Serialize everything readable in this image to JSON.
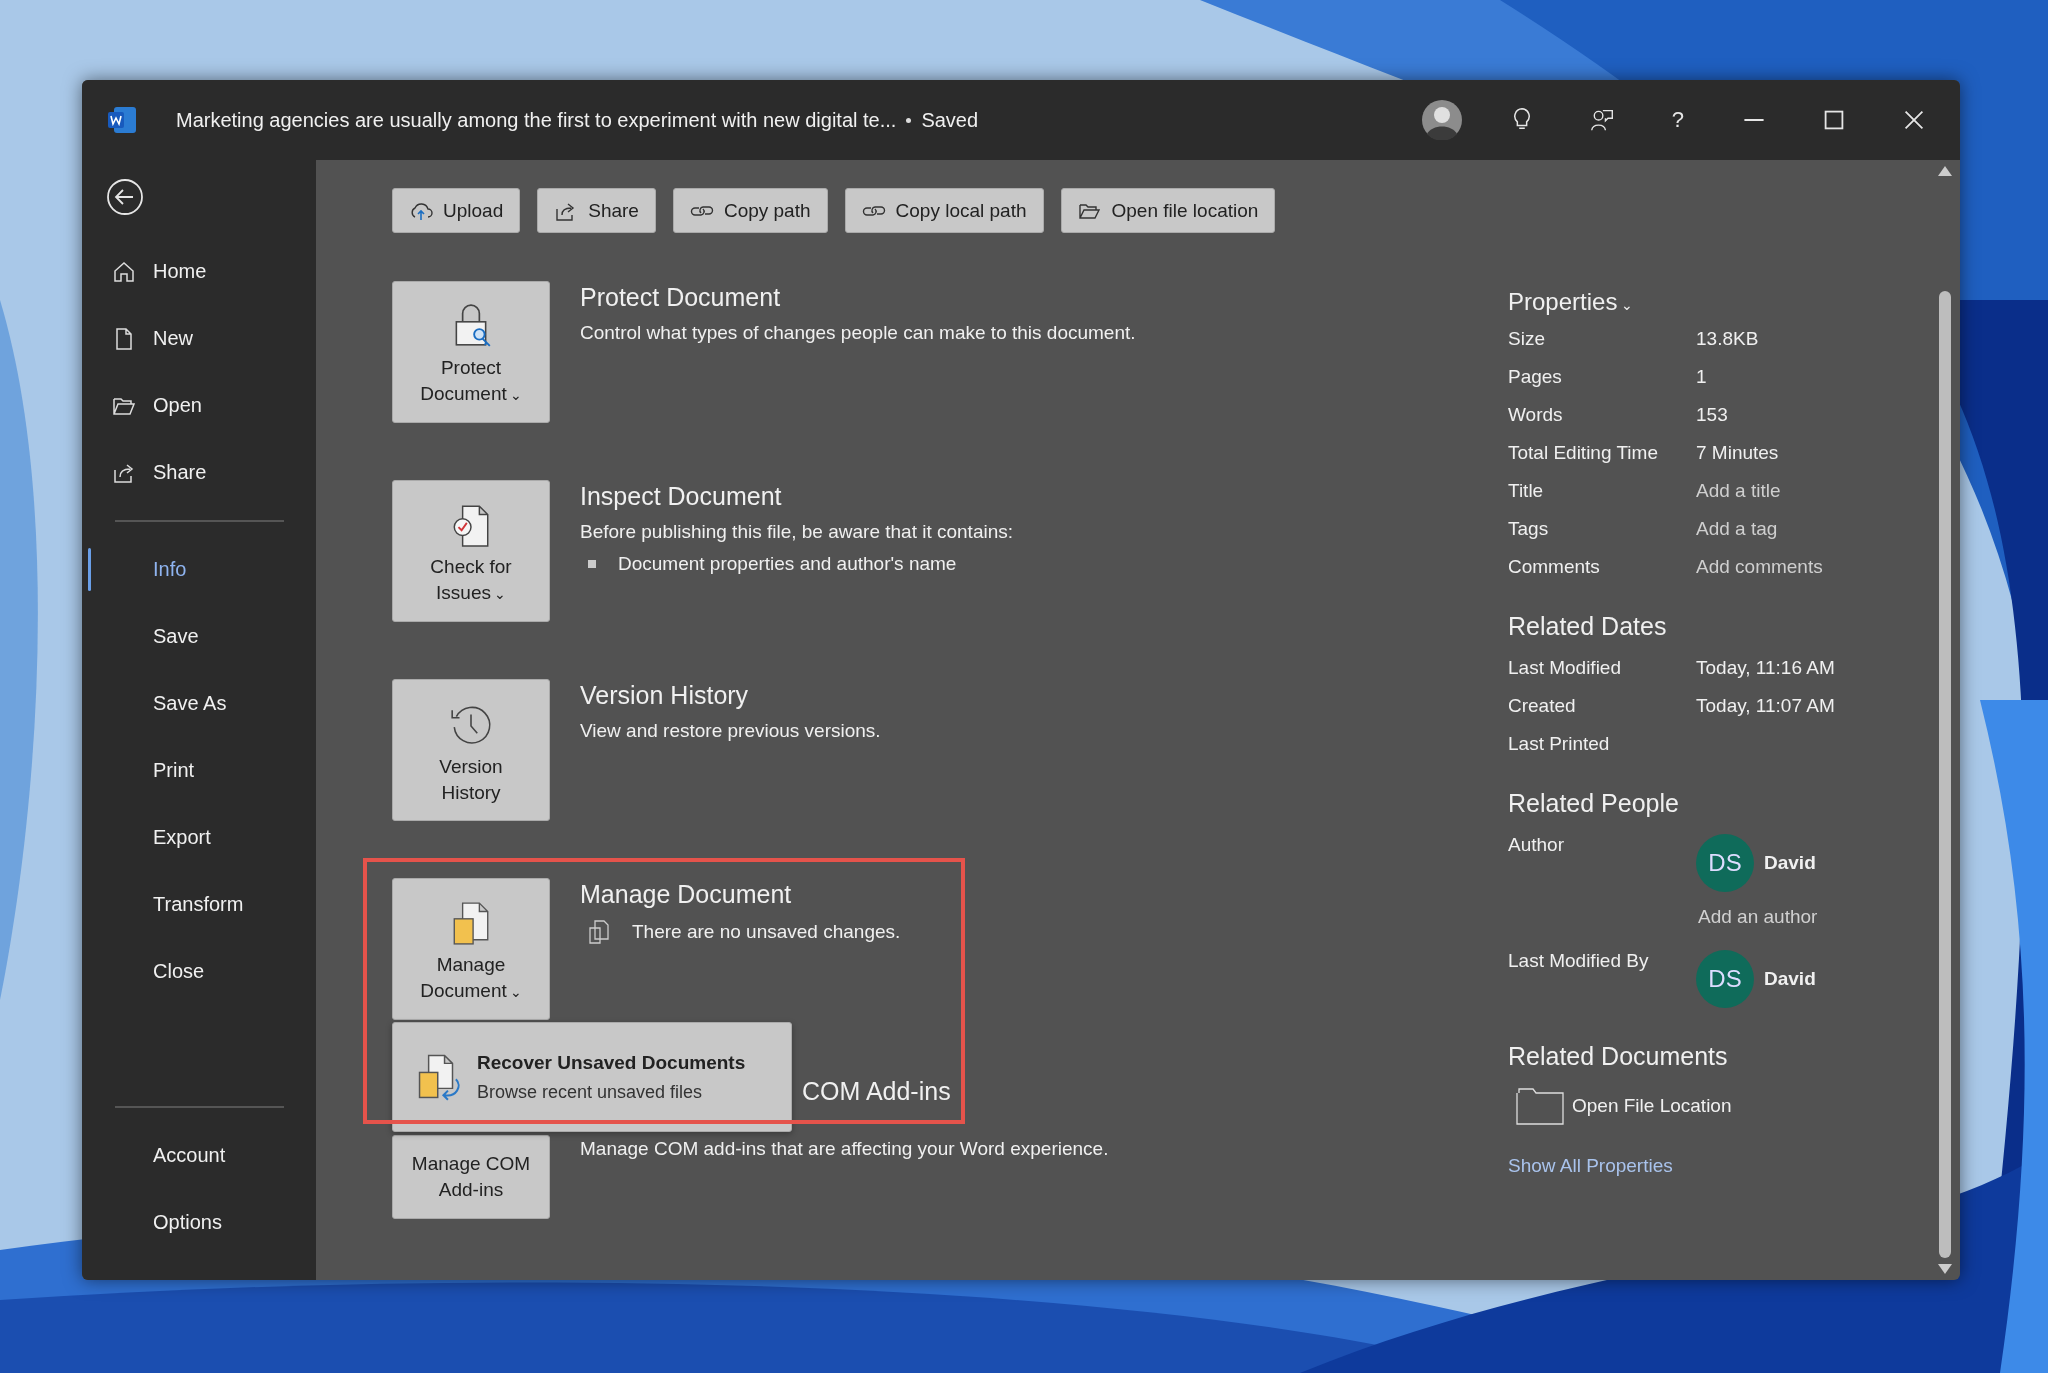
{
  "window": {
    "title": "Marketing agencies are usually among the first to experiment with new digital te...",
    "status": "Saved",
    "help": "?"
  },
  "sidebar": {
    "top_items": [
      {
        "label": "Home",
        "selected": false
      },
      {
        "label": "New",
        "selected": false
      },
      {
        "label": "Open",
        "selected": false
      },
      {
        "label": "Share",
        "selected": false
      }
    ],
    "items": [
      {
        "label": "Info",
        "selected": true
      },
      {
        "label": "Save",
        "selected": false
      },
      {
        "label": "Save As",
        "selected": false
      },
      {
        "label": "Print",
        "selected": false
      },
      {
        "label": "Export",
        "selected": false
      },
      {
        "label": "Transform",
        "selected": false
      },
      {
        "label": "Close",
        "selected": false
      }
    ],
    "bottom_items": [
      {
        "label": "Account",
        "selected": false
      },
      {
        "label": "Options",
        "selected": false
      }
    ]
  },
  "actions": [
    "Upload",
    "Share",
    "Copy path",
    "Copy local path",
    "Open file location"
  ],
  "sections": [
    {
      "kind": "protect",
      "button": [
        "Protect",
        "Document"
      ],
      "caret": "⌄",
      "title": "Protect Document",
      "description": "Control what types of changes people can make to this document."
    },
    {
      "kind": "inspect",
      "button": [
        "Check for",
        "Issues"
      ],
      "caret": "⌄",
      "title": "Inspect Document",
      "description": "Before publishing this file, be aware that it contains:",
      "bullets": [
        "Document properties and author's name"
      ]
    },
    {
      "kind": "version",
      "button": [
        "Version",
        "History"
      ],
      "title": "Version History",
      "description": "View and restore previous versions."
    },
    {
      "kind": "manage",
      "button": [
        "Manage",
        "Document"
      ],
      "caret": "⌄",
      "highlighted": true,
      "title": "Manage Document",
      "status": "There are no unsaved changes.",
      "menu": {
        "title": "Recover Unsaved Documents",
        "subtitle": "Browse recent unsaved files"
      }
    },
    {
      "kind": "com",
      "button": [
        "Manage COM",
        "Add-ins"
      ],
      "title": "COM Add-ins",
      "description": "Manage COM add-ins that are affecting your Word experience."
    }
  ],
  "properties": {
    "title": "Properties",
    "caret": "⌄",
    "rows": [
      {
        "label": "Size",
        "value": "13.8KB",
        "editable": false
      },
      {
        "label": "Pages",
        "value": "1",
        "editable": false
      },
      {
        "label": "Words",
        "value": "153",
        "editable": false
      },
      {
        "label": "Total Editing Time",
        "value": "7 Minutes",
        "editable": false
      },
      {
        "label": "Title",
        "value": "Add a title",
        "editable": true
      },
      {
        "label": "Tags",
        "value": "Add a tag",
        "editable": true
      },
      {
        "label": "Comments",
        "value": "Add comments",
        "editable": true
      }
    ]
  },
  "related_dates": {
    "title": "Related Dates",
    "rows": [
      {
        "label": "Last Modified",
        "value": "Today, 11:16 AM"
      },
      {
        "label": "Created",
        "value": "Today, 11:07 AM"
      },
      {
        "label": "Last Printed"
      }
    ]
  },
  "related_people": {
    "title": "Related People",
    "groups": [
      {
        "label": "Author",
        "people": [
          {
            "initials": "DS",
            "name": "David"
          }
        ],
        "add": "Add an author"
      },
      {
        "label": "Last Modified By",
        "people": [
          {
            "initials": "DS",
            "name": "David"
          }
        ]
      }
    ]
  },
  "related_documents": {
    "title": "Related Documents",
    "items": [
      "Open File Location"
    ]
  },
  "show_all": "Show All Properties"
}
